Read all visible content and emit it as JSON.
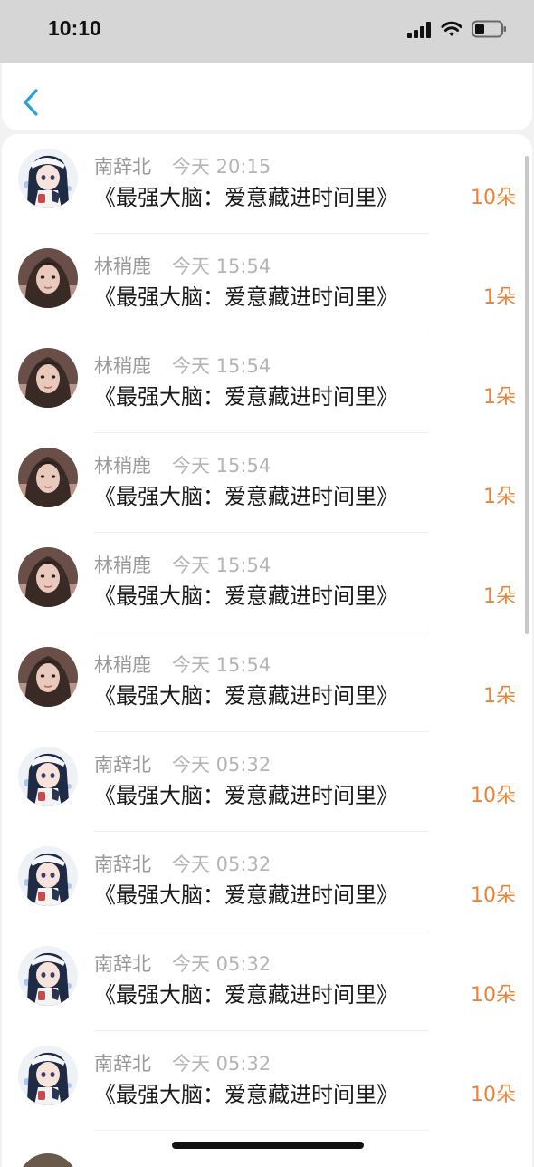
{
  "status_bar": {
    "time": "10:10",
    "icons": [
      "cellular-signal-icon",
      "wifi-icon",
      "battery-icon"
    ]
  },
  "header": {
    "back_icon": "chevron-left-icon",
    "accent_color": "#2a9fd8"
  },
  "colors": {
    "amount": "#e8843a",
    "name": "#9a9a9a",
    "time": "#b5b5b5",
    "title": "#1a1a1a"
  },
  "gifts": [
    {
      "name": "南辞北",
      "time": "今天 20:15",
      "title": "《最强大脑：爱意藏进时间里》",
      "amount": "10朵",
      "avatar": "anime-girl-avatar"
    },
    {
      "name": "林稍鹿",
      "time": "今天 15:54",
      "title": "《最强大脑：爱意藏进时间里》",
      "amount": "1朵",
      "avatar": "portrait-girl-avatar"
    },
    {
      "name": "林稍鹿",
      "time": "今天 15:54",
      "title": "《最强大脑：爱意藏进时间里》",
      "amount": "1朵",
      "avatar": "portrait-girl-avatar"
    },
    {
      "name": "林稍鹿",
      "time": "今天 15:54",
      "title": "《最强大脑：爱意藏进时间里》",
      "amount": "1朵",
      "avatar": "portrait-girl-avatar"
    },
    {
      "name": "林稍鹿",
      "time": "今天 15:54",
      "title": "《最强大脑：爱意藏进时间里》",
      "amount": "1朵",
      "avatar": "portrait-girl-avatar"
    },
    {
      "name": "林稍鹿",
      "time": "今天 15:54",
      "title": "《最强大脑：爱意藏进时间里》",
      "amount": "1朵",
      "avatar": "portrait-girl-avatar"
    },
    {
      "name": "南辞北",
      "time": "今天 05:32",
      "title": "《最强大脑：爱意藏进时间里》",
      "amount": "10朵",
      "avatar": "anime-girl-avatar"
    },
    {
      "name": "南辞北",
      "time": "今天 05:32",
      "title": "《最强大脑：爱意藏进时间里》",
      "amount": "10朵",
      "avatar": "anime-girl-avatar"
    },
    {
      "name": "南辞北",
      "time": "今天 05:32",
      "title": "《最强大脑：爱意藏进时间里》",
      "amount": "10朵",
      "avatar": "anime-girl-avatar"
    },
    {
      "name": "南辞北",
      "time": "今天 05:32",
      "title": "《最强大脑：爱意藏进时间里》",
      "amount": "10朵",
      "avatar": "anime-girl-avatar"
    }
  ]
}
